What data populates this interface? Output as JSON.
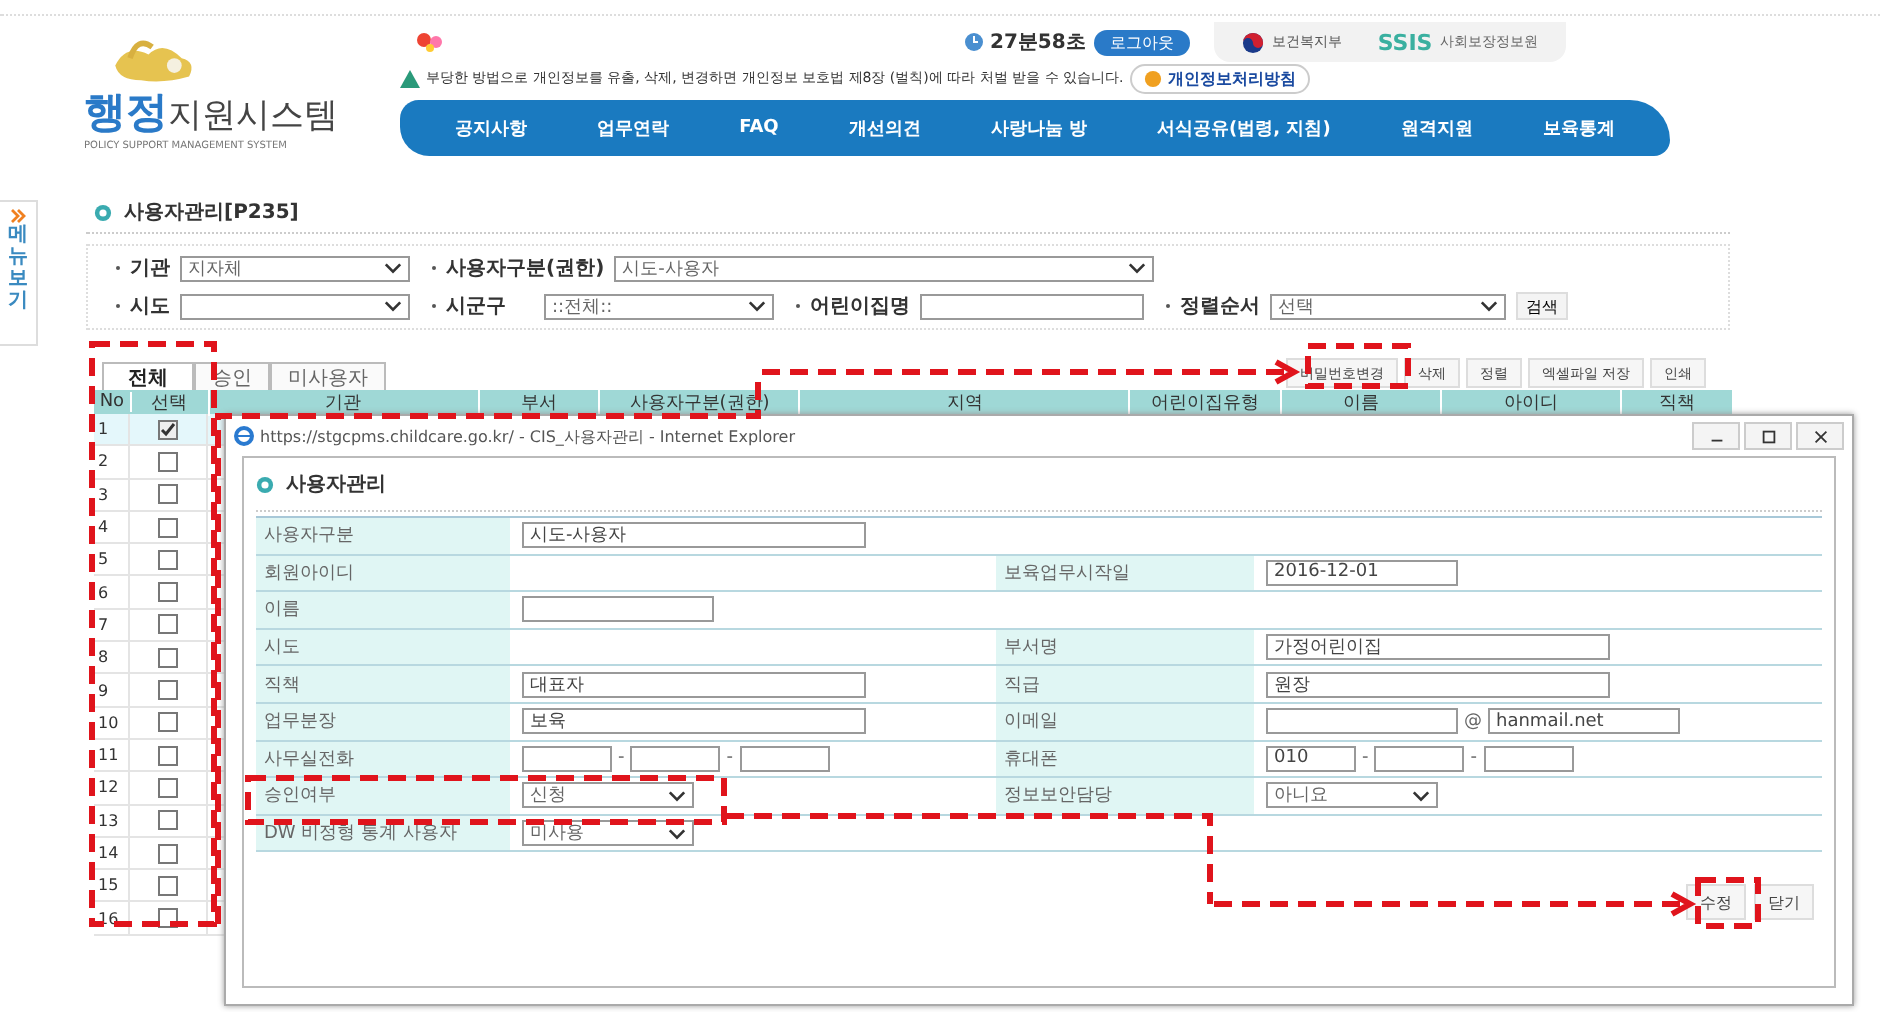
{
  "header": {
    "logo_accent": "행정",
    "logo_title": "지원시스템",
    "logo_subtitle": "POLICY SUPPORT MANAGEMENT SYSTEM",
    "session_timer": "27분58초",
    "logout_button": "로그아웃",
    "ministry_logo": "보건복지부",
    "institute_logo": {
      "mark": "SSIS",
      "name": "사회보장정보원"
    },
    "warning": "부당한 방법으로 개인정보를 유출, 삭제, 변경하면 개인정보 보호법 제8장 (벌칙)에 따라 처벌 받을 수 있습니다.",
    "privacy_button": "개인정보처리방침",
    "nav": [
      "공지사항",
      "업무연락",
      "FAQ",
      "개선의견",
      "사랑나눔 방",
      "서식공유(법령, 지침)",
      "원격지원",
      "보육통계"
    ]
  },
  "side_tab": "메뉴보기",
  "page_title": "사용자관리[P235]",
  "filters": [
    [
      {
        "label": "기관",
        "kind": "select",
        "value": "지자체"
      },
      {
        "label": "사용자구분(권한)",
        "kind": "select",
        "value": "시도-사용자"
      }
    ],
    [
      {
        "label": "시도",
        "kind": "select"
      },
      {
        "label": "시군구",
        "kind": "select",
        "value": "::전체::"
      },
      {
        "label": "어린이집명",
        "kind": "input"
      },
      {
        "label": "정렬순서",
        "kind": "select",
        "value": "선택"
      },
      {
        "kind": "button",
        "value": "검색"
      }
    ]
  ],
  "tabs": [
    {
      "label": "전체",
      "selected": true
    },
    {
      "label": "승인",
      "selected": false
    },
    {
      "label": "미사용자",
      "selected": false
    }
  ],
  "action_buttons": [
    "비밀번호변경",
    "삭제",
    "정렬",
    "엑셀파일 저장",
    "인쇄"
  ],
  "table": {
    "columns": [
      "No",
      "선택",
      "기관",
      "부서",
      "사용자구분(권한)",
      "지역",
      "어린이집유형",
      "이름",
      "아이디",
      "직책"
    ],
    "rows": [
      {
        "no": "1",
        "checked": true,
        "selected": true
      },
      {
        "no": "2",
        "checked": false,
        "selected": false
      },
      {
        "no": "3",
        "checked": false,
        "selected": false
      },
      {
        "no": "4",
        "checked": false,
        "selected": false
      },
      {
        "no": "5",
        "checked": false,
        "selected": false
      },
      {
        "no": "6",
        "checked": false,
        "selected": false
      },
      {
        "no": "7",
        "checked": false,
        "selected": false
      },
      {
        "no": "8",
        "checked": false,
        "selected": false
      },
      {
        "no": "9",
        "checked": false,
        "selected": false
      },
      {
        "no": "10",
        "checked": false,
        "selected": false
      },
      {
        "no": "11",
        "checked": false,
        "selected": false
      },
      {
        "no": "12",
        "checked": false,
        "selected": false
      },
      {
        "no": "13",
        "checked": false,
        "selected": false
      },
      {
        "no": "14",
        "checked": false,
        "selected": false
      },
      {
        "no": "15",
        "checked": false,
        "selected": false
      },
      {
        "no": "16",
        "checked": false,
        "selected": false
      }
    ]
  },
  "popup": {
    "title": "https://stgcpms.childcare.go.kr/ - CIS_사용자관리 - Internet Explorer",
    "heading": "사용자관리",
    "form": [
      [
        {
          "label": "사용자구분",
          "kind": "input",
          "value": "시도-사용자"
        }
      ],
      [
        {
          "label": "회원아이디",
          "kind": "empty"
        },
        {
          "label": "보육업무시작일",
          "kind": "date",
          "value": "2016-12-01"
        }
      ],
      [
        {
          "label": "이름",
          "kind": "short"
        }
      ],
      [
        {
          "label": "시도",
          "kind": "empty"
        },
        {
          "label": "부서명",
          "kind": "input",
          "value": "가정어린이집"
        }
      ],
      [
        {
          "label": "직책",
          "kind": "input",
          "value": "대표자"
        },
        {
          "label": "직급",
          "kind": "input",
          "value": "원장"
        }
      ],
      [
        {
          "label": "업무분장",
          "kind": "input",
          "value": "보육"
        },
        {
          "label": "이메일",
          "kind": "email",
          "value": "hanmail.net",
          "separator": "@"
        }
      ],
      [
        {
          "label": "사무실전화",
          "kind": "phone",
          "separators": [
            "-",
            "-"
          ]
        },
        {
          "label": "휴대폰",
          "kind": "phone",
          "value": "010",
          "separators": [
            "-",
            "-"
          ]
        }
      ],
      [
        {
          "label": "승인여부",
          "kind": "select",
          "value": "신청"
        },
        {
          "label": "정보보안담당",
          "kind": "select",
          "value": "아니요"
        }
      ],
      [
        {
          "label": "DW 비정형 통계 사용자",
          "kind": "select",
          "value": "미사용"
        }
      ]
    ],
    "buttons": [
      "수정",
      "닫기"
    ]
  }
}
